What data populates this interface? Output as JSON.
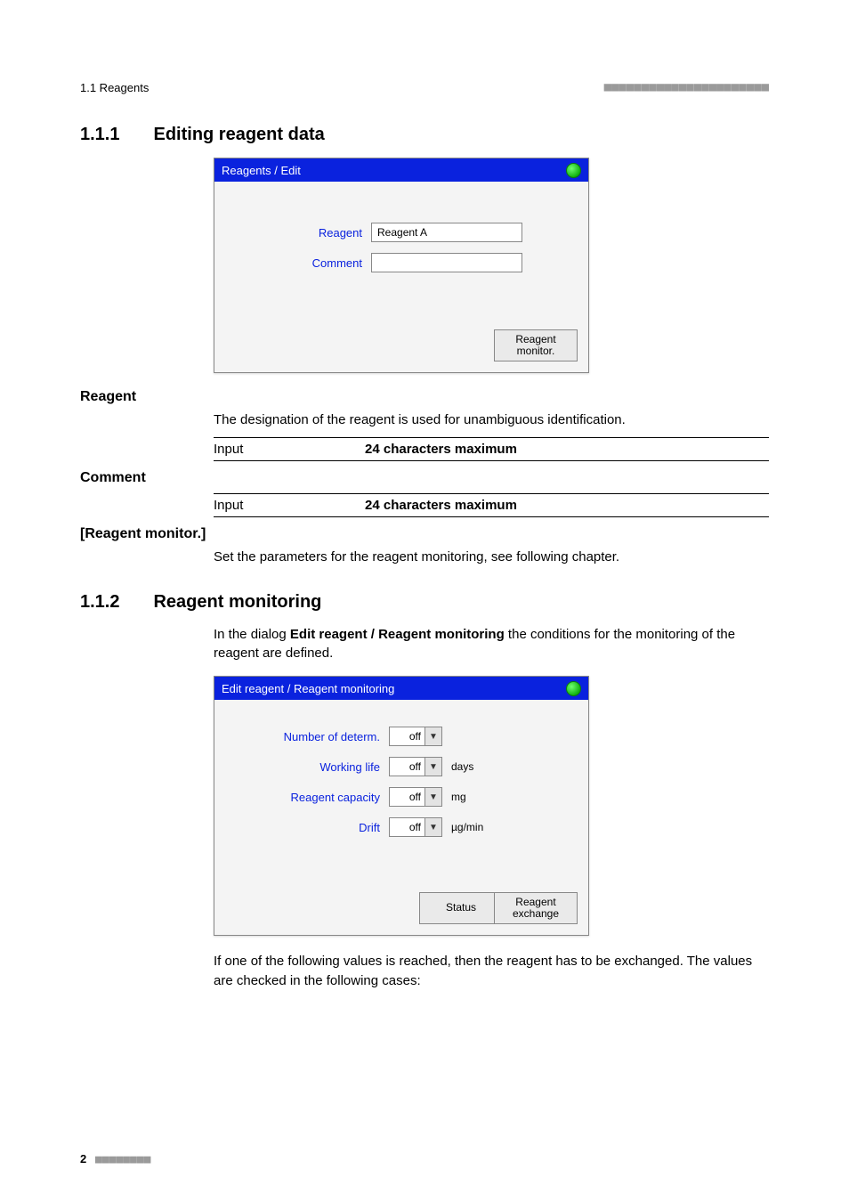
{
  "runningHead": {
    "left": "1.1 Reagents",
    "dashes": "■■■■■■■■■■■■■■■■■■■■■■"
  },
  "sections": {
    "s111": {
      "num": "1.1.1",
      "title": "Editing reagent data"
    },
    "s112": {
      "num": "1.1.2",
      "title": "Reagent monitoring"
    }
  },
  "dialog1": {
    "title": "Reagents / Edit",
    "labels": {
      "reagent": "Reagent",
      "comment": "Comment"
    },
    "values": {
      "reagent": "Reagent A",
      "comment": ""
    },
    "buttons": {
      "reagentMonitor": "Reagent\nmonitor."
    }
  },
  "defs": {
    "reagent": {
      "term": "Reagent",
      "desc": "The designation of the reagent is used for unambiguous identification.",
      "inputLabel": "Input",
      "inputLimit": "24 characters maximum"
    },
    "comment": {
      "term": "Comment",
      "inputLabel": "Input",
      "inputLimit": "24 characters maximum"
    },
    "reagentMonitor": {
      "term": "[Reagent monitor.]",
      "desc": "Set the parameters for the reagent monitoring, see following chapter."
    }
  },
  "s112Intro": {
    "pre": "In the dialog ",
    "bold": "Edit reagent / Reagent monitoring",
    "post": " the conditions for the monitoring of the reagent are defined."
  },
  "dialog2": {
    "title": "Edit reagent / Reagent monitoring",
    "rows": {
      "determ": {
        "label": "Number of determ.",
        "value": "off",
        "unit": ""
      },
      "life": {
        "label": "Working life",
        "value": "off",
        "unit": "days"
      },
      "cap": {
        "label": "Reagent capacity",
        "value": "off",
        "unit": "mg"
      },
      "drift": {
        "label": "Drift",
        "value": "off",
        "unit": "µg/min"
      }
    },
    "buttons": {
      "status": "Status",
      "exchange": "Reagent\nexchange"
    }
  },
  "footText": "If one of the following values is reached, then the reagent has to be exchanged. The values are checked in the following cases:",
  "pageNumber": {
    "num": "2",
    "dashes": "■■■■■■■■"
  }
}
